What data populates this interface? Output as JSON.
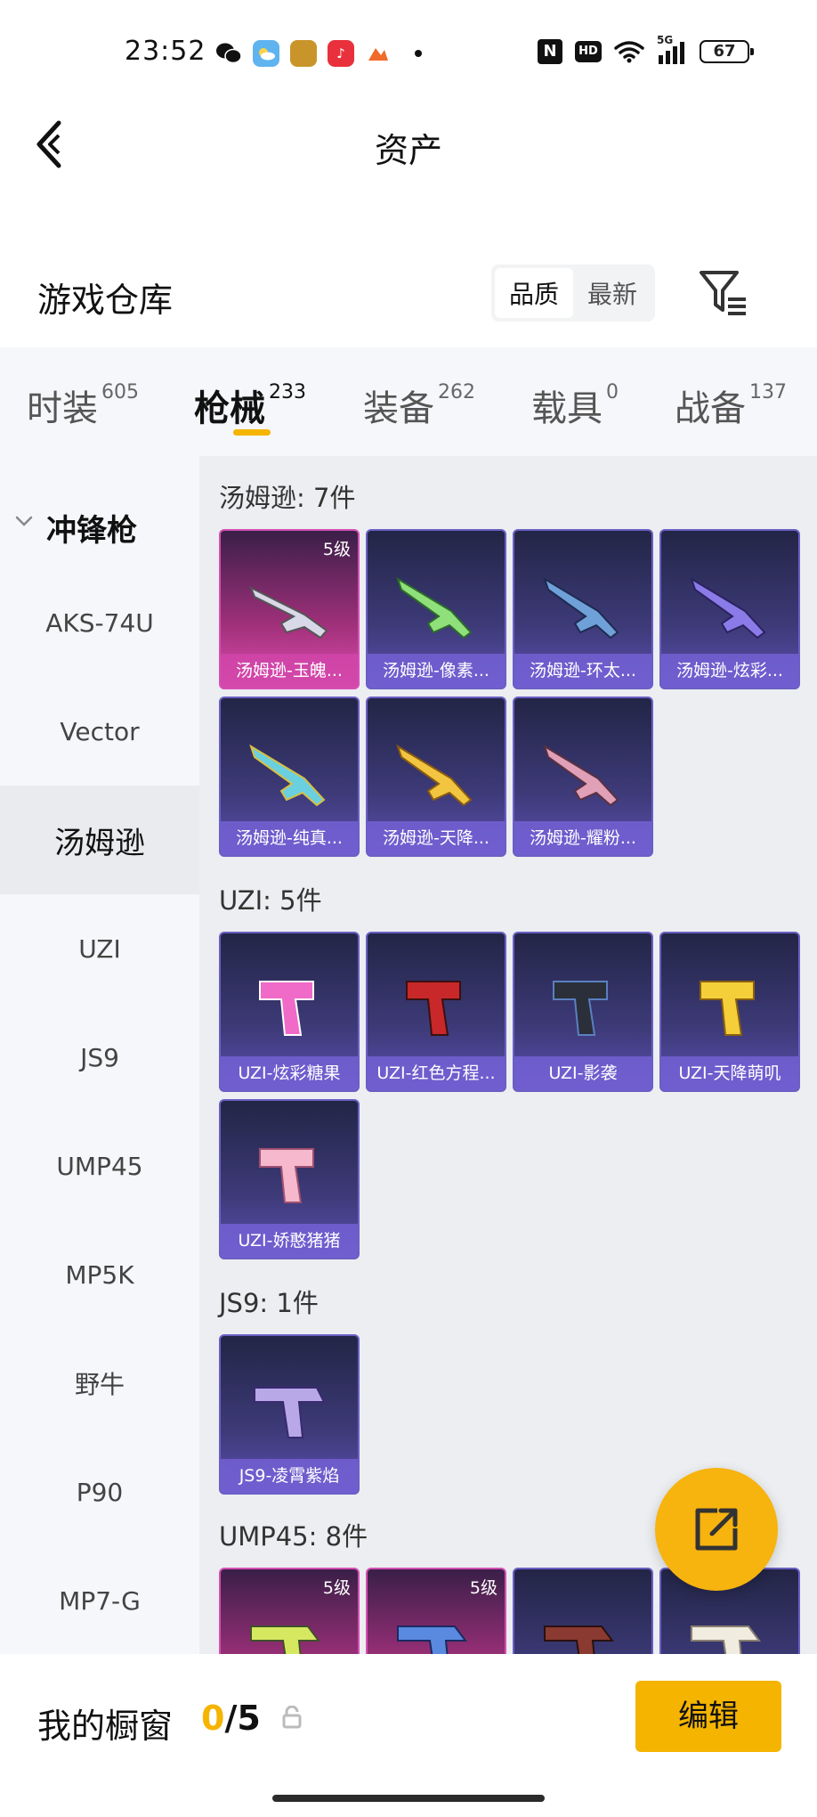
{
  "status_bar": {
    "time": "23:52",
    "signal": "5G",
    "battery": "67",
    "icons": [
      "wechat-icon",
      "weather-icon",
      "game-icon",
      "music-icon",
      "app-icon",
      "nfc-icon",
      "hd-icon",
      "wifi-icon",
      "signal-icon",
      "battery-icon"
    ]
  },
  "header": {
    "title": "资产"
  },
  "warehouse": {
    "title": "游戏仓库",
    "sort_options": [
      "品质",
      "最新"
    ],
    "sort_selected": "品质"
  },
  "tabs": [
    {
      "label": "时装",
      "count": "605"
    },
    {
      "label": "枪械",
      "count": "233"
    },
    {
      "label": "装备",
      "count": "262"
    },
    {
      "label": "载具",
      "count": "0"
    },
    {
      "label": "战备",
      "count": "137"
    }
  ],
  "sidebar": {
    "group": "冲锋枪",
    "items": [
      "AKS-74U",
      "Vector",
      "汤姆逊",
      "UZI",
      "JS9",
      "UMP45",
      "MP5K",
      "野牛",
      "P90",
      "MP7-G"
    ],
    "active": "汤姆逊"
  },
  "sections": [
    {
      "title": "汤姆逊: 7件",
      "items": [
        {
          "name": "汤姆逊-玉魄...",
          "level": "5级",
          "color": "#d54fb3"
        },
        {
          "name": "汤姆逊-像素...",
          "level": "",
          "color": "#6a5fc4"
        },
        {
          "name": "汤姆逊-环太...",
          "level": "",
          "color": "#6a5fc4"
        },
        {
          "name": "汤姆逊-炫彩...",
          "level": "",
          "color": "#6a5fc4"
        },
        {
          "name": "汤姆逊-纯真...",
          "level": "",
          "color": "#6a5fc4"
        },
        {
          "name": "汤姆逊-天降...",
          "level": "",
          "color": "#6a5fc4"
        },
        {
          "name": "汤姆逊-耀粉...",
          "level": "",
          "color": "#6a5fc4"
        }
      ]
    },
    {
      "title": "UZI: 5件",
      "items": [
        {
          "name": "UZI-炫彩糖果",
          "level": ""
        },
        {
          "name": "UZI-红色方程...",
          "level": ""
        },
        {
          "name": "UZI-影袭",
          "level": ""
        },
        {
          "name": "UZI-天降萌叽",
          "level": ""
        },
        {
          "name": "UZI-娇憨猪猪",
          "level": ""
        }
      ]
    },
    {
      "title": "JS9: 1件",
      "items": [
        {
          "name": "JS9-凌霄紫焰",
          "level": ""
        }
      ]
    },
    {
      "title": "UMP45: 8件",
      "items": [
        {
          "name": "",
          "level": "5级"
        },
        {
          "name": "",
          "level": "5级"
        },
        {
          "name": "",
          "level": ""
        },
        {
          "name": "",
          "level": ""
        }
      ]
    }
  ],
  "bottom_bar": {
    "label": "我的橱窗",
    "used": "0",
    "slash": "/",
    "total": "5",
    "edit_label": "编辑"
  },
  "colors": {
    "accent": "#f5b400",
    "epic": "#6a5fc4",
    "legendary": "#d54fb3"
  }
}
